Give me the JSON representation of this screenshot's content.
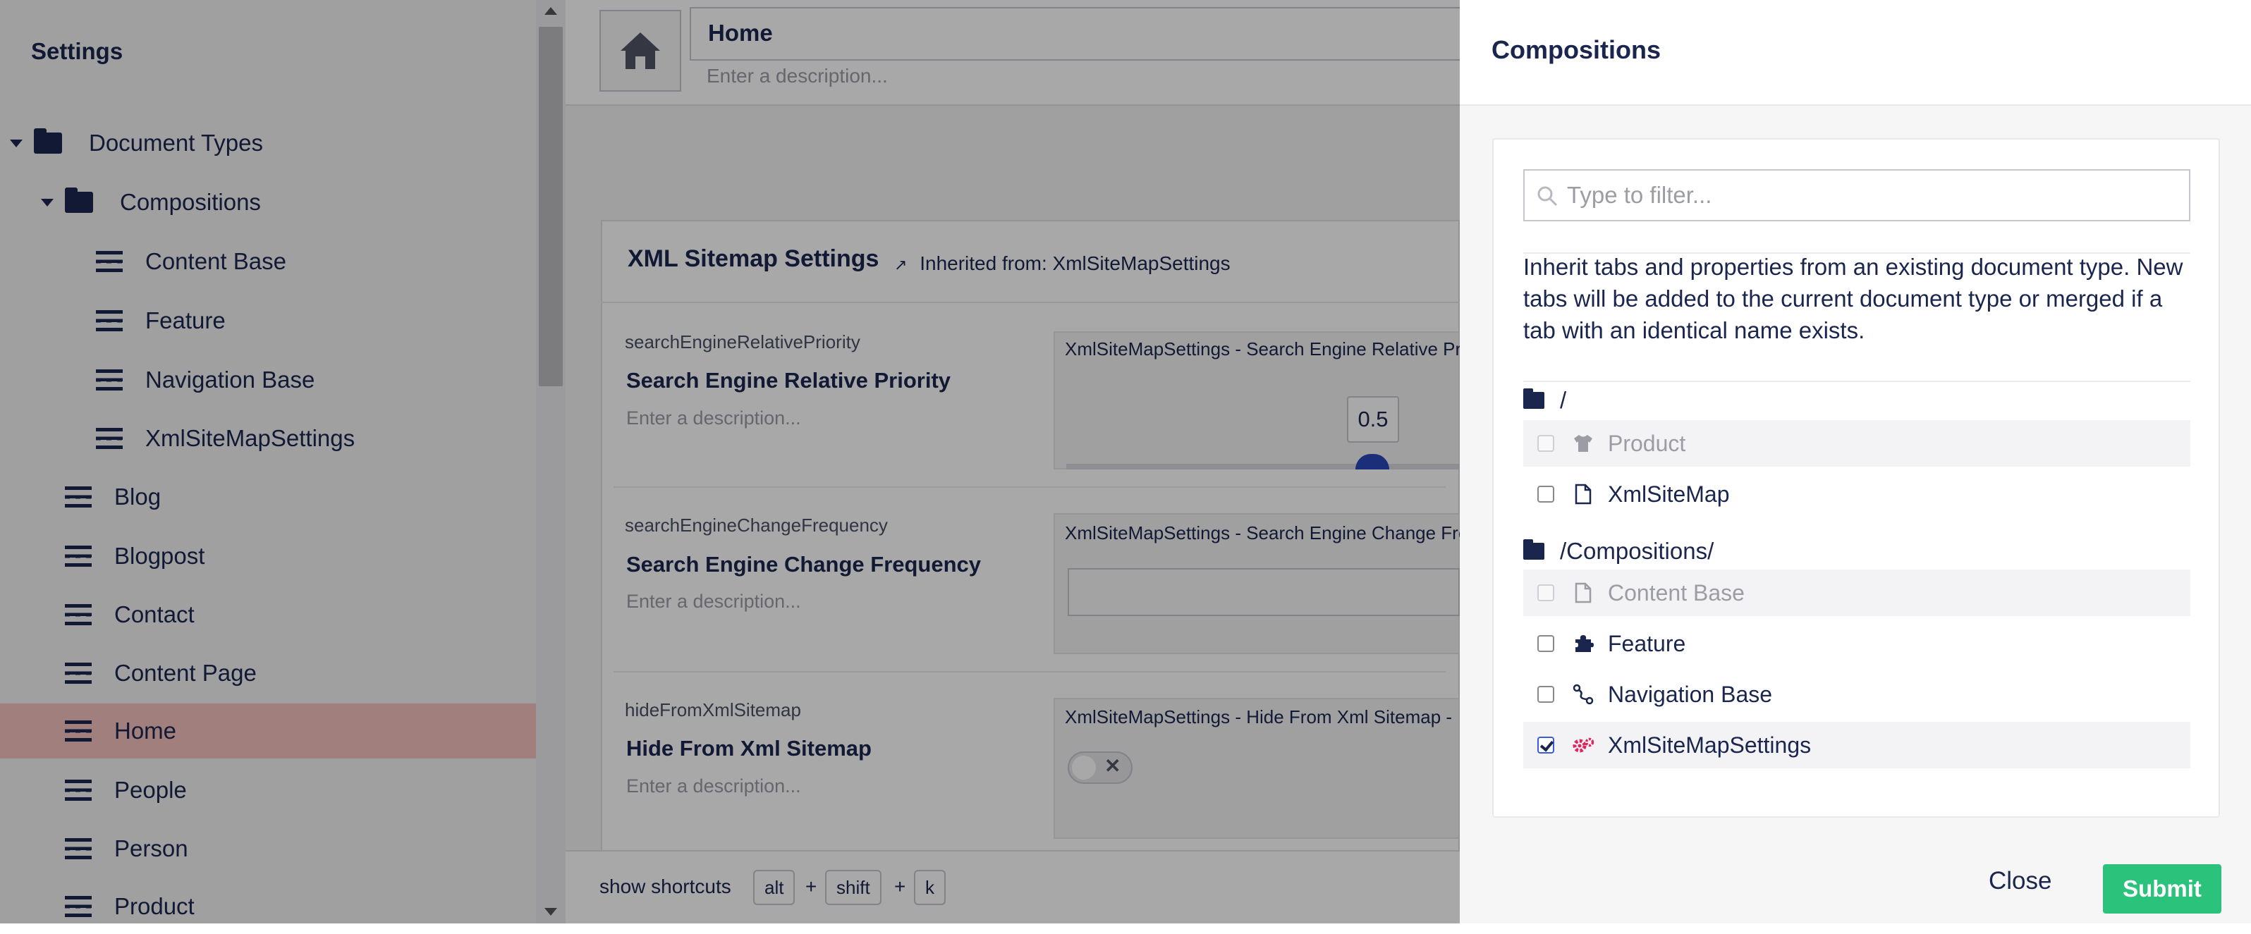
{
  "tree": {
    "title": "Settings",
    "items": [
      {
        "label": "Document Types"
      },
      {
        "label": "Compositions"
      },
      {
        "label": "Content Base"
      },
      {
        "label": "Feature"
      },
      {
        "label": "Navigation Base"
      },
      {
        "label": "XmlSiteMapSettings"
      },
      {
        "label": "Blog"
      },
      {
        "label": "Blogpost"
      },
      {
        "label": "Contact"
      },
      {
        "label": "Content Page"
      },
      {
        "label": "Home"
      },
      {
        "label": "People"
      },
      {
        "label": "Person"
      },
      {
        "label": "Product"
      }
    ]
  },
  "editor": {
    "name": "Home",
    "description_placeholder": "Enter a description...",
    "group": {
      "title": "XML Sitemap Settings",
      "inherited": "Inherited from: XmlSiteMapSettings"
    },
    "properties": [
      {
        "alias": "searchEngineRelativePriority",
        "label": "Search Engine Relative Priority",
        "description": "Enter a description...",
        "editor_header": "XmlSiteMapSettings - Search Engine Relative Priority",
        "slider_value": "0.5"
      },
      {
        "alias": "searchEngineChangeFrequency",
        "label": "Search Engine Change Frequency",
        "description": "Enter a description...",
        "editor_header": "XmlSiteMapSettings - Search Engine Change Frequency"
      },
      {
        "alias": "hideFromXmlSitemap",
        "label": "Hide From Xml Sitemap",
        "description": "Enter a description...",
        "editor_header": "XmlSiteMapSettings - Hide From Xml Sitemap -"
      }
    ],
    "shortcuts": {
      "label": "show shortcuts",
      "keys": [
        "alt",
        "shift",
        "k"
      ],
      "plus": "+"
    }
  },
  "dialog": {
    "title": "Compositions",
    "filter_placeholder": "Type to filter...",
    "help": "Inherit tabs and properties from an existing document type. New tabs will be added to the current document type or merged if a tab with an identical name exists.",
    "folders": [
      {
        "path": "/",
        "items": [
          {
            "label": "Product",
            "icon": "shirt-icon",
            "disabled": true,
            "checked": false
          },
          {
            "label": "XmlSiteMap",
            "icon": "document-icon",
            "disabled": false,
            "checked": false
          }
        ]
      },
      {
        "path": "/Compositions/",
        "items": [
          {
            "label": "Content Base",
            "icon": "document-icon",
            "disabled": true,
            "checked": false
          },
          {
            "label": "Feature",
            "icon": "puzzle-icon",
            "disabled": false,
            "checked": false
          },
          {
            "label": "Navigation Base",
            "icon": "path-icon",
            "disabled": false,
            "checked": false
          },
          {
            "label": "XmlSiteMapSettings",
            "icon": "gears-icon",
            "disabled": false,
            "checked": true
          }
        ]
      }
    ],
    "close_label": "Close",
    "submit_label": "Submit"
  },
  "colors": {
    "primary_text": "#1b264f",
    "selected_tree_item": "#f5c1bc",
    "submit": "#2bc37c",
    "settings_icon_accent": "#e0245e"
  }
}
